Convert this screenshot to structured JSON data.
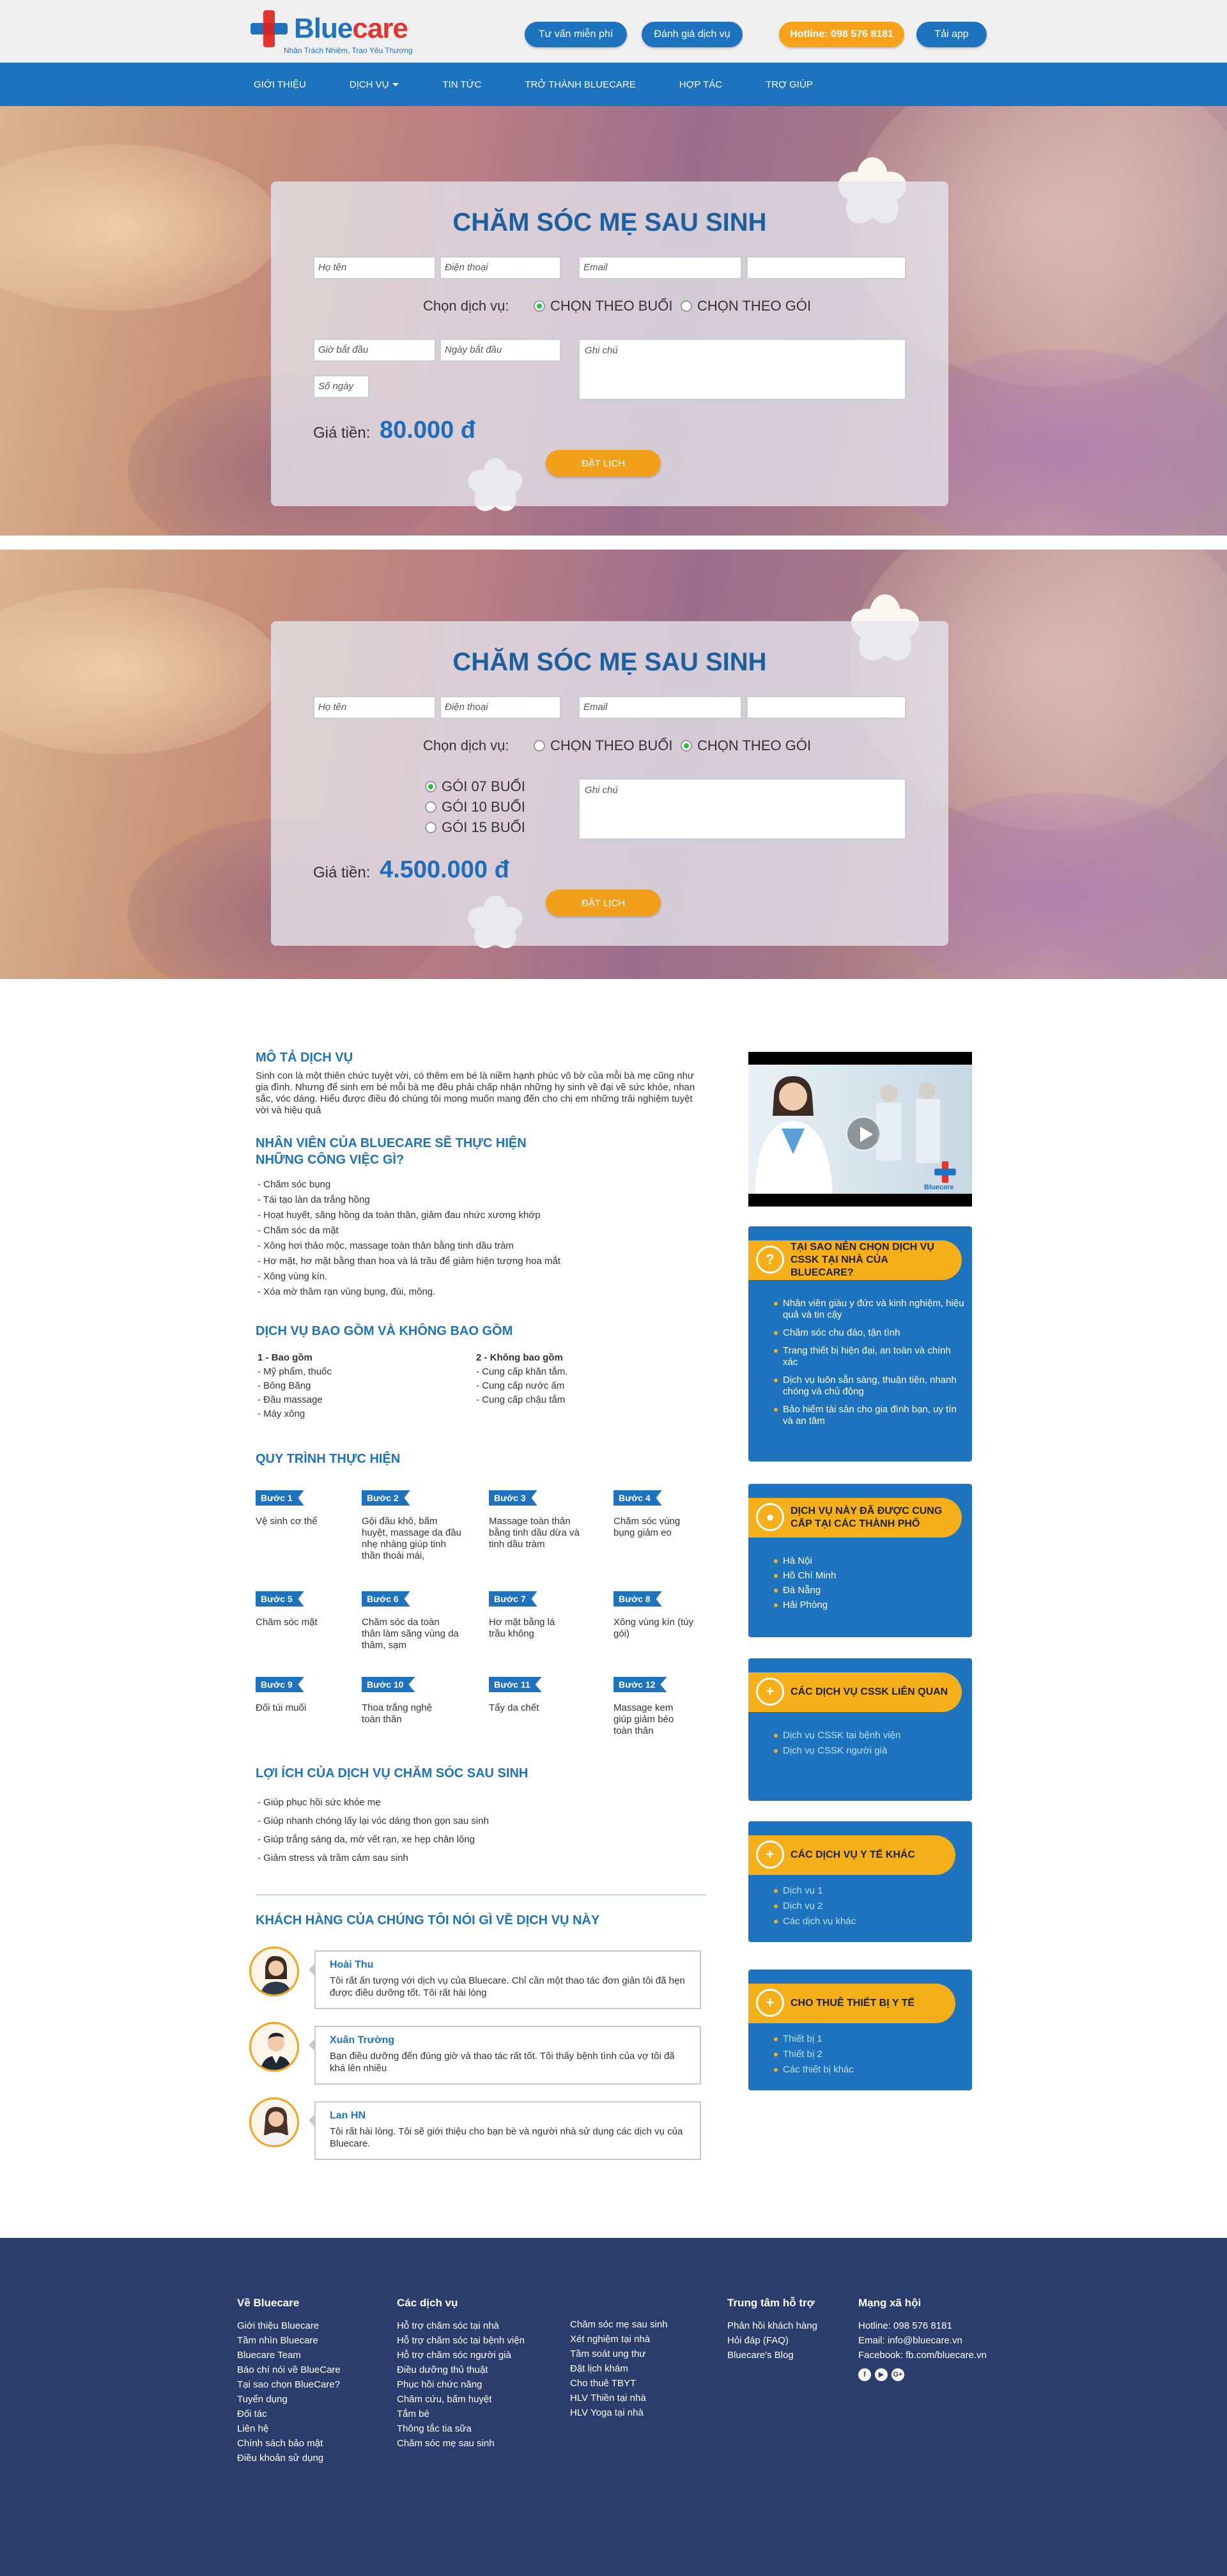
{
  "header": {
    "logo_word_a": "Blue",
    "logo_word_b": "care",
    "tagline": "Nhân Trách Nhiệm, Trao Yêu Thương",
    "buttons": {
      "consult": "Tư vấn miễn phí",
      "rate": "Đánh giá dịch vụ",
      "hotline": "Hotline: 098 576 8181",
      "app": "Tải app"
    }
  },
  "nav": {
    "items": [
      "Giới thiệu",
      "Dịch vụ",
      "Tin tức",
      "Trở thành Bluecare",
      "Hợp tác",
      "Trợ giúp"
    ]
  },
  "booking_session": {
    "title": "CHĂM SÓC MẸ SAU SINH",
    "name_ph": "Họ tên",
    "phone_ph": "Điện thoại",
    "email_ph": "Email",
    "extra_ph": "",
    "choose_label": "Chọn dịch vụ:",
    "opt_session": "CHỌN THEO BUỔI",
    "opt_package": "CHỌN THEO GÓI",
    "selected": "session",
    "start_time_ph": "Giờ bắt đầu",
    "start_date_ph": "Ngày bắt đầu",
    "days_ph": "Số ngày",
    "note_ph": "Ghi chú",
    "price_label": "Giá tiền:",
    "price": "80.000 đ",
    "book": "ĐẶT LỊCH"
  },
  "booking_package": {
    "title": "CHĂM SÓC MẸ SAU SINH",
    "name_ph": "Họ tên",
    "phone_ph": "Điện thoại",
    "email_ph": "Email",
    "extra_ph": "",
    "choose_label": "Chọn dịch vụ:",
    "opt_session": "CHỌN THEO BUỔI",
    "opt_package": "CHỌN THEO GÓI",
    "selected": "package",
    "packages": [
      "GÓI 07 BUỔI",
      "GÓI 10 BUỔI",
      "GÓI 15 BUỔI"
    ],
    "package_selected": 0,
    "note_ph": "Ghi chú",
    "price_label": "Giá tiền:",
    "price": "4.500.000 đ",
    "book": "ĐẶT LỊCH"
  },
  "content": {
    "desc_title": "MÔ TẢ DỊCH VỤ",
    "desc_text": "Sinh con là một thiên chức tuyệt vời, có thêm em bé là niềm hạnh phúc vô bờ của mỗi bà mẹ cũng như gia đình. Nhưng để sinh em bé mỗi bà mẹ đều phải chấp nhận những hy sinh về đại về sức khỏe, nhan sắc, vóc dáng. Hiểu được điều đó chúng tôi mong muốn mang đến cho chị em những trải nghiệm tuyệt vời và hiệu quả",
    "tasks_title": "NHÂN VIÊN CỦA BLUECARE SẼ THỰC HIỆN NHỮNG CÔNG VIỆC GÌ?",
    "tasks": [
      "- Chăm sóc bụng",
      "- Tái tạo làn da trắng hồng",
      "- Hoạt huyết, săng hồng da toàn thân, giảm đau nhức xương khớp",
      "- Chăm sóc da mặt",
      "- Xông hơi thảo mộc, massage toàn thân bằng tinh dầu tràm",
      "- Hơ mặt, hơ mặt bằng than hoa và lá trầu để giảm hiện tượng hoa mắt",
      "- Xông vùng kín.",
      "- Xóa mờ thâm rạn vùng bụng, đùi, mông."
    ],
    "incl_title": "DỊCH VỤ BAO GỒM VÀ KHÔNG BAO GỒM",
    "incl_head": "1 - Bao gồm",
    "incl": [
      "- Mỹ phẩm, thuốc",
      "- Bông Băng",
      "- Đầu massage",
      "- Máy xông"
    ],
    "excl_head": "2 - Không bao gồm",
    "excl": [
      "- Cung cấp khăn tắm.",
      "- Cung cấp nước ấm",
      "- Cung cấp chậu tắm"
    ],
    "process_title": "QUY TRÌNH THỰC HIỆN",
    "steps": [
      {
        "badge": "Bước 1",
        "text": "Vệ sinh cơ thể"
      },
      {
        "badge": "Bước 2",
        "text": "Gội đầu khô, bấm huyệt, massage da đầu nhẹ nhàng giúp tinh thần thoải mái,"
      },
      {
        "badge": "Bước 3",
        "text": "Massage toàn thân bằng tinh dầu dừa và tinh dầu tràm"
      },
      {
        "badge": "Bước 4",
        "text": "Chăm sóc vùng bụng giảm eo"
      },
      {
        "badge": "Bước 5",
        "text": "Chăm sóc mặt"
      },
      {
        "badge": "Bước 6",
        "text": "Chăm sóc da toàn thân làm săng vùng da thâm, sạm"
      },
      {
        "badge": "Bước 7",
        "text": "Hơ mặt bằng lá trầu không"
      },
      {
        "badge": "Bước 8",
        "text": "Xông vùng kín (tùy gói)"
      },
      {
        "badge": "Bước 9",
        "text": "Đối túi muối"
      },
      {
        "badge": "Bước 10",
        "text": "Thoa trắng nghệ toàn thân"
      },
      {
        "badge": "Bước 11",
        "text": "Tẩy da chết"
      },
      {
        "badge": "Bước 12",
        "text": "Massage kem giúp giảm béo toàn thân"
      }
    ],
    "benefit_title": "LỢI ÍCH CỦA DỊCH VỤ CHĂM SÓC SAU SINH",
    "benefits": [
      "- Giúp phục hồi sức khỏe mẹ",
      "- Giúp nhanh chóng lấy lại vóc dáng thon gọn sau sinh",
      "- Giúp trắng sáng da, mờ vết rạn, xe hẹp chân lông",
      "- Giảm stress và trầm cảm sau sinh"
    ],
    "reviews_title": "KHÁCH HÀNG CỦA CHÚNG TÔI NÓI GÌ VỀ DỊCH VỤ NÀY",
    "reviews": [
      {
        "name": "Hoài Thu",
        "text": "Tôi rất ấn tượng với dịch vụ của Bluecare. Chỉ cần một thao tác đơn giản tôi đã hẹn được điều dưỡng tốt. Tôi rất hài lòng"
      },
      {
        "name": "Xuân Trường",
        "text": "Bạn điều dưỡng đến đúng giờ và thao tác rất tốt. Tôi thấy bệnh tình của vợ tôi đã khá lên nhiều"
      },
      {
        "name": "Lan HN",
        "text": "Tôi rất hài lòng. Tôi sẽ giới thiệu cho bạn bè và người nhà sử dụng các dịch vụ của Bluecare."
      }
    ]
  },
  "sidebar": {
    "video_brand": "Bluecare",
    "why_title": "TẠI SAO NÊN CHỌN DỊCH VỤ CSSK TẠI NHÀ CỦA BLUECARE?",
    "why_icon": "?",
    "why_items": [
      "Nhân viên giàu y đức và kinh nghiệm, hiệu quả và tin cậy",
      "Chăm sóc chu đáo, tận tình",
      "Trang thiết bị hiện đại, an toàn và chính xác",
      "Dịch vụ luôn sẵn sàng, thuận tiện, nhanh chóng và chủ động",
      "Bảo hiểm tài sản cho gia đình bạn, uy tín và an tâm"
    ],
    "cities_title": "DỊCH VỤ NÀY ĐÃ ĐƯỢC CUNG CẤP TẠI CÁC THÀNH PHỐ",
    "cities_icon": "●",
    "cities": [
      "Hà Nội",
      "Hồ Chí Minh",
      "Đà Nẵng",
      "Hải Phòng"
    ],
    "related_title": "CÁC DỊCH VỤ CSSK LIÊN QUAN",
    "related_icon": "+",
    "related": [
      "Dịch vụ CSSK tại bệnh viện",
      "Dịch vụ CSSK người già"
    ],
    "medical_title": "CÁC DỊCH VỤ Y TẾ KHÁC",
    "medical_icon": "+",
    "medical": [
      "Dịch vụ 1",
      "Dịch vụ 2",
      "Các dịch vụ khác"
    ],
    "rent_title": "CHO THUÊ THIẾT BỊ Y TẾ",
    "rent_icon": "+",
    "rent": [
      "Thiết bị 1",
      "Thiết bị 2",
      "Các thiết bị khác"
    ]
  },
  "footer": {
    "about_title": "Về Bluecare",
    "about": [
      "Giới thiệu Bluecare",
      "Tầm nhìn Bluecare",
      "Bluecare Team",
      "Báo chí nói về BlueCare",
      "Tại sao chọn BlueCare?",
      "Tuyển dụng",
      "Đối tác",
      "Liên hệ",
      "Chính sách bảo mật",
      "Điều khoản sử dụng"
    ],
    "services_title": "Các dịch vụ",
    "services_a": [
      "Hỗ trợ chăm sóc tại nhà",
      "Hỗ trợ chăm sóc tại bệnh viện",
      "Hỗ trợ chăm sóc người già",
      "Điều dưỡng thủ thuật",
      "Phục hồi chức năng",
      "Châm cứu, bấm huyệt",
      "Tắm bé",
      "Thông tắc tia sữa",
      "Chăm sóc mẹ sau sinh"
    ],
    "services_b": [
      "Chăm sóc mẹ sau sinh",
      "Xét nghiệm tại nhà",
      "Tầm soát ung thư",
      "Đặt lịch khám",
      "Cho thuê TBYT",
      "HLV Thiền tại nhà",
      "HLV Yoga tại nhà"
    ],
    "support_title": "Trung tâm hỗ trợ",
    "support": [
      "Phản hồi khách hàng",
      "Hỏi đáp (FAQ)",
      "Bluecare's Blog"
    ],
    "social_title": "Mạng xã hội",
    "social": [
      "Hotline: 098 576 8181",
      "Email: info@bluecare.vn",
      "Facebook: fb.com/bluecare.vn"
    ],
    "social_icons": [
      "f",
      "▶",
      "G+"
    ]
  }
}
